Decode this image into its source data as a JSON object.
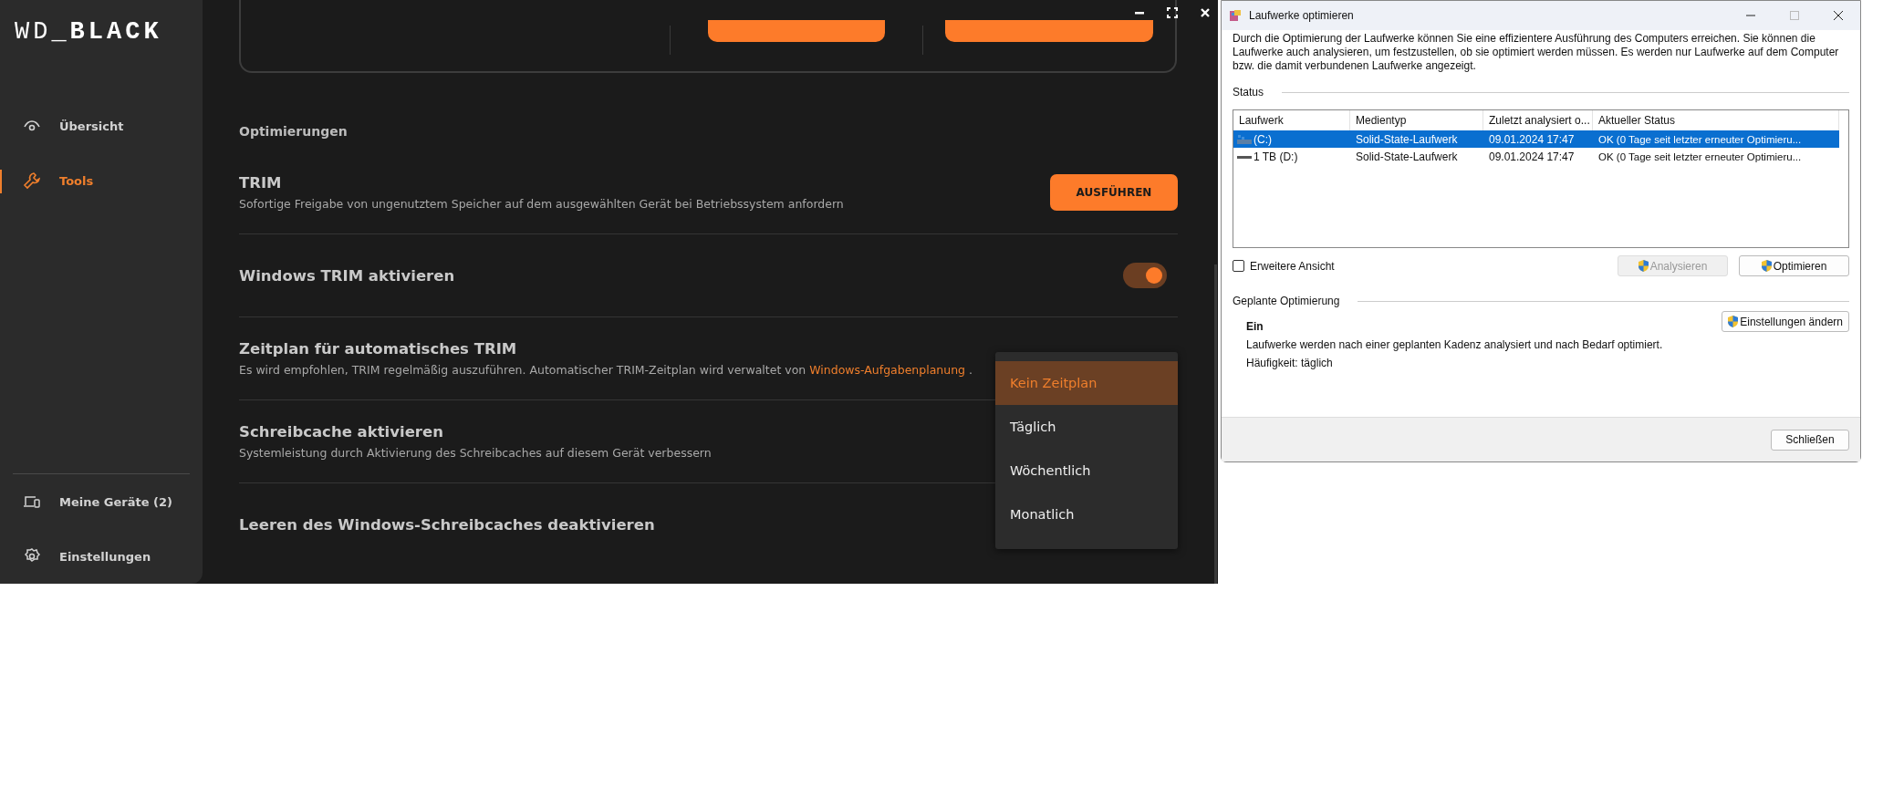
{
  "app": {
    "logo": {
      "left": "WD_",
      "right": "BLACK"
    },
    "nav": [
      {
        "label": "Übersicht",
        "selected": false
      },
      {
        "label": "Tools",
        "selected": true
      }
    ],
    "nav_bottom": [
      {
        "label": "Meine Geräte (2)"
      },
      {
        "label": "Einstellungen"
      }
    ],
    "section": "Optimierungen",
    "settings": [
      {
        "kind": "button",
        "title": "TRIM",
        "desc": "Sofortige Freigabe von ungenutztem Speicher auf dem ausgewählten Gerät bei Betriebssystem anfordern",
        "button": "AUSFÜHREN"
      },
      {
        "kind": "toggle",
        "title": "Windows TRIM aktivieren",
        "on": true
      },
      {
        "kind": "schedule",
        "title": "Zeitplan für automatisches TRIM",
        "desc": "Es wird empfohlen, TRIM regelmäßig auszuführen. Automatischer TRIM-Zeitplan wird verwaltet von",
        "link": "Windows-Aufgabenplanung",
        "after": "."
      },
      {
        "kind": "text",
        "title": "Schreibcache aktivieren",
        "desc": "Systemleistung durch Aktivierung des Schreibcaches auf diesem Gerät verbessern"
      },
      {
        "kind": "text",
        "title": "Leeren des Windows-Schreibcaches deaktivieren"
      }
    ],
    "dropdown": [
      {
        "label": "Kein Zeitplan",
        "selected": true
      },
      {
        "label": "Täglich",
        "selected": false
      },
      {
        "label": "Wöchentlich",
        "selected": false
      },
      {
        "label": "Monatlich",
        "selected": false
      }
    ]
  },
  "dialog": {
    "title": "Laufwerke optimieren",
    "intro": "Durch die Optimierung der Laufwerke können Sie eine effizientere Ausführung des Computers erreichen. Sie können die Laufwerke auch analysieren, um festzustellen, ob sie optimiert werden müssen. Es werden nur Laufwerke auf dem Computer bzw. die damit verbundenen Laufwerke angezeigt.",
    "status_label": "Status",
    "columns": [
      "Laufwerk",
      "Medientyp",
      "Zuletzt analysiert o...",
      "Aktueller Status"
    ],
    "rows": [
      {
        "cells": [
          "(C:)",
          "Solid-State-Laufwerk",
          "09.01.2024 17:47",
          "OK (0 Tage seit letzter erneuter Optimieru..."
        ],
        "kind": "system",
        "selected": true
      },
      {
        "cells": [
          "1 TB (D:)",
          "Solid-State-Laufwerk",
          "09.01.2024 17:47",
          "OK (0 Tage seit letzter erneuter Optimieru..."
        ],
        "kind": "disk",
        "selected": false
      }
    ],
    "checkbox": {
      "label": "Erweitere Ansicht",
      "checked": false
    },
    "buttons": [
      {
        "label": "Analysieren",
        "disabled": true
      },
      {
        "label": "Optimieren",
        "disabled": false
      }
    ],
    "scheduled_label": "Geplante Optimierung",
    "scheduled_state": "Ein",
    "scheduled_desc": "Laufwerke werden nach einer geplanten Kadenz analysiert und nach Bedarf optimiert.",
    "frequency": "Häufigkeit: täglich",
    "change_button": "Einstellungen ändern",
    "close_button": "Schließen"
  }
}
